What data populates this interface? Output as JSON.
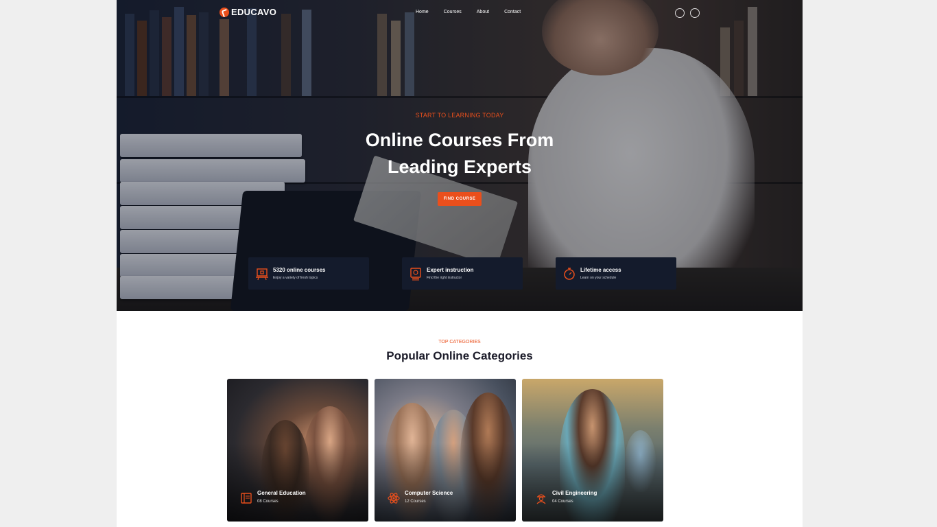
{
  "brand": {
    "name": "EDUCAVO",
    "accent": "#ea4f1c",
    "dark": "#141b2c"
  },
  "nav": {
    "links": [
      "Home",
      "Courses",
      "About",
      "Contact"
    ],
    "icons": [
      "search-icon",
      "user-icon"
    ]
  },
  "hero": {
    "eyebrow": "START TO LEARNING TODAY",
    "title_line1": "Online Courses From",
    "title_line2": "Leading Experts",
    "cta": "FIND COURSE"
  },
  "features": [
    {
      "icon": "online-course-icon",
      "title": "5320 online courses",
      "subtitle": "Enjoy a variety of fresh topics"
    },
    {
      "icon": "expert-certificate-icon",
      "title": "Expert instruction",
      "subtitle": "Find the right instructor"
    },
    {
      "icon": "stopwatch-icon",
      "title": "Lifetime access",
      "subtitle": "Learn on your schedule"
    }
  ],
  "categories": {
    "eyebrow": "TOP CATEGORIES",
    "title": "Popular Online Categories",
    "items": [
      {
        "icon": "book-icon",
        "title": "General Education",
        "count": "08 Courses"
      },
      {
        "icon": "atom-icon",
        "title": "Computer Science",
        "count": "12 Courses"
      },
      {
        "icon": "engineer-icon",
        "title": "Civil Engineering",
        "count": "04 Courses"
      }
    ]
  }
}
